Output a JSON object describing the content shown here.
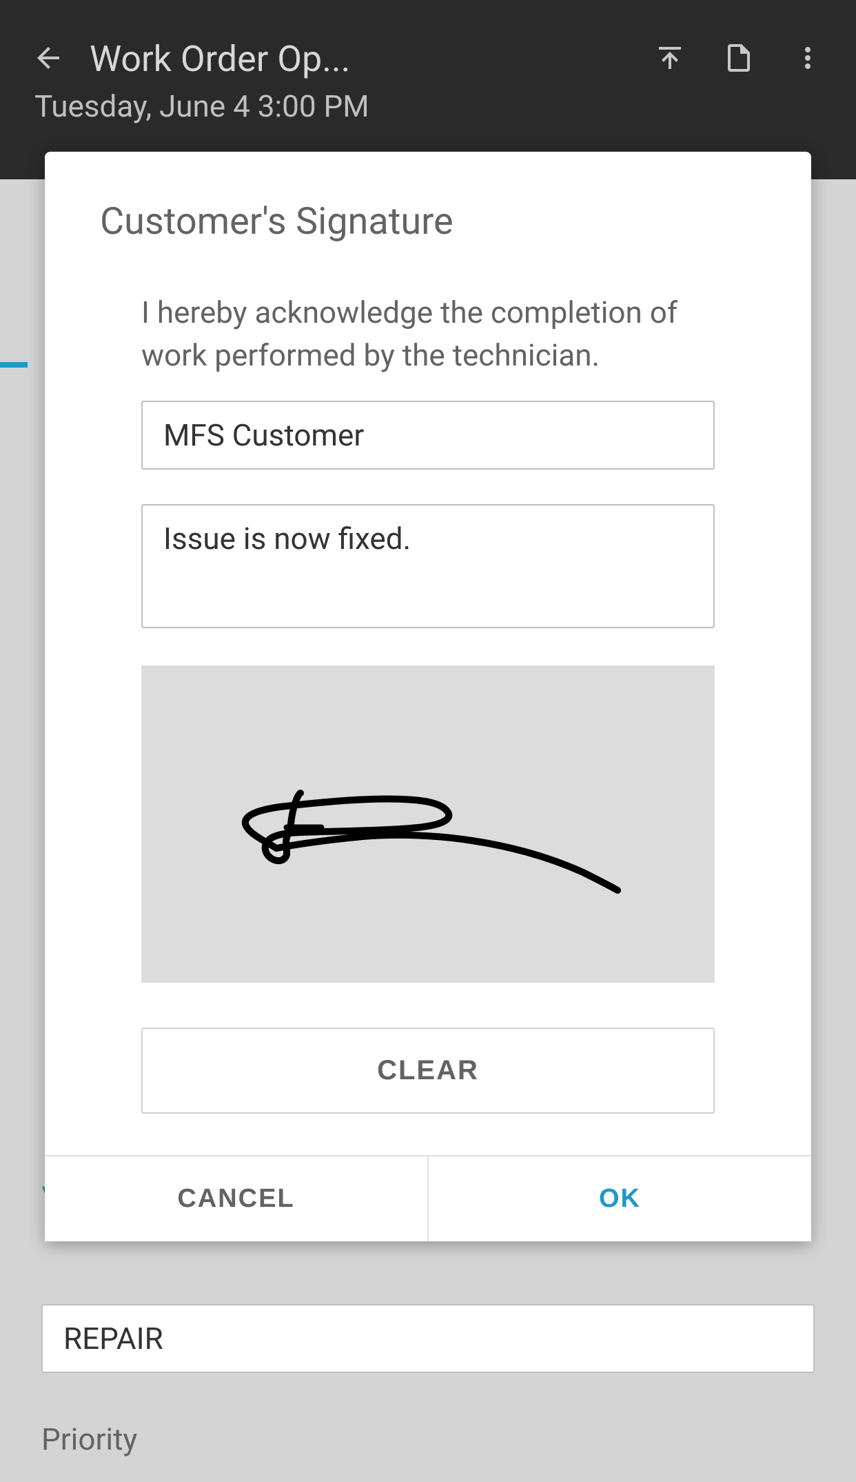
{
  "appBar": {
    "title": "Work Order Op...",
    "subtitle": "Tuesday, June 4 3:00 PM"
  },
  "background": {
    "sectionTitleChar": "\\",
    "fieldValue": "REPAIR",
    "priorityLabel": "Priority"
  },
  "modal": {
    "title": "Customer's Signature",
    "acknowledgement": "I hereby acknowledge the completion of work performed by the technician.",
    "customerName": "MFS Customer",
    "notes": "Issue is now fixed.",
    "clearLabel": "CLEAR",
    "cancelLabel": "CANCEL",
    "okLabel": "OK"
  }
}
